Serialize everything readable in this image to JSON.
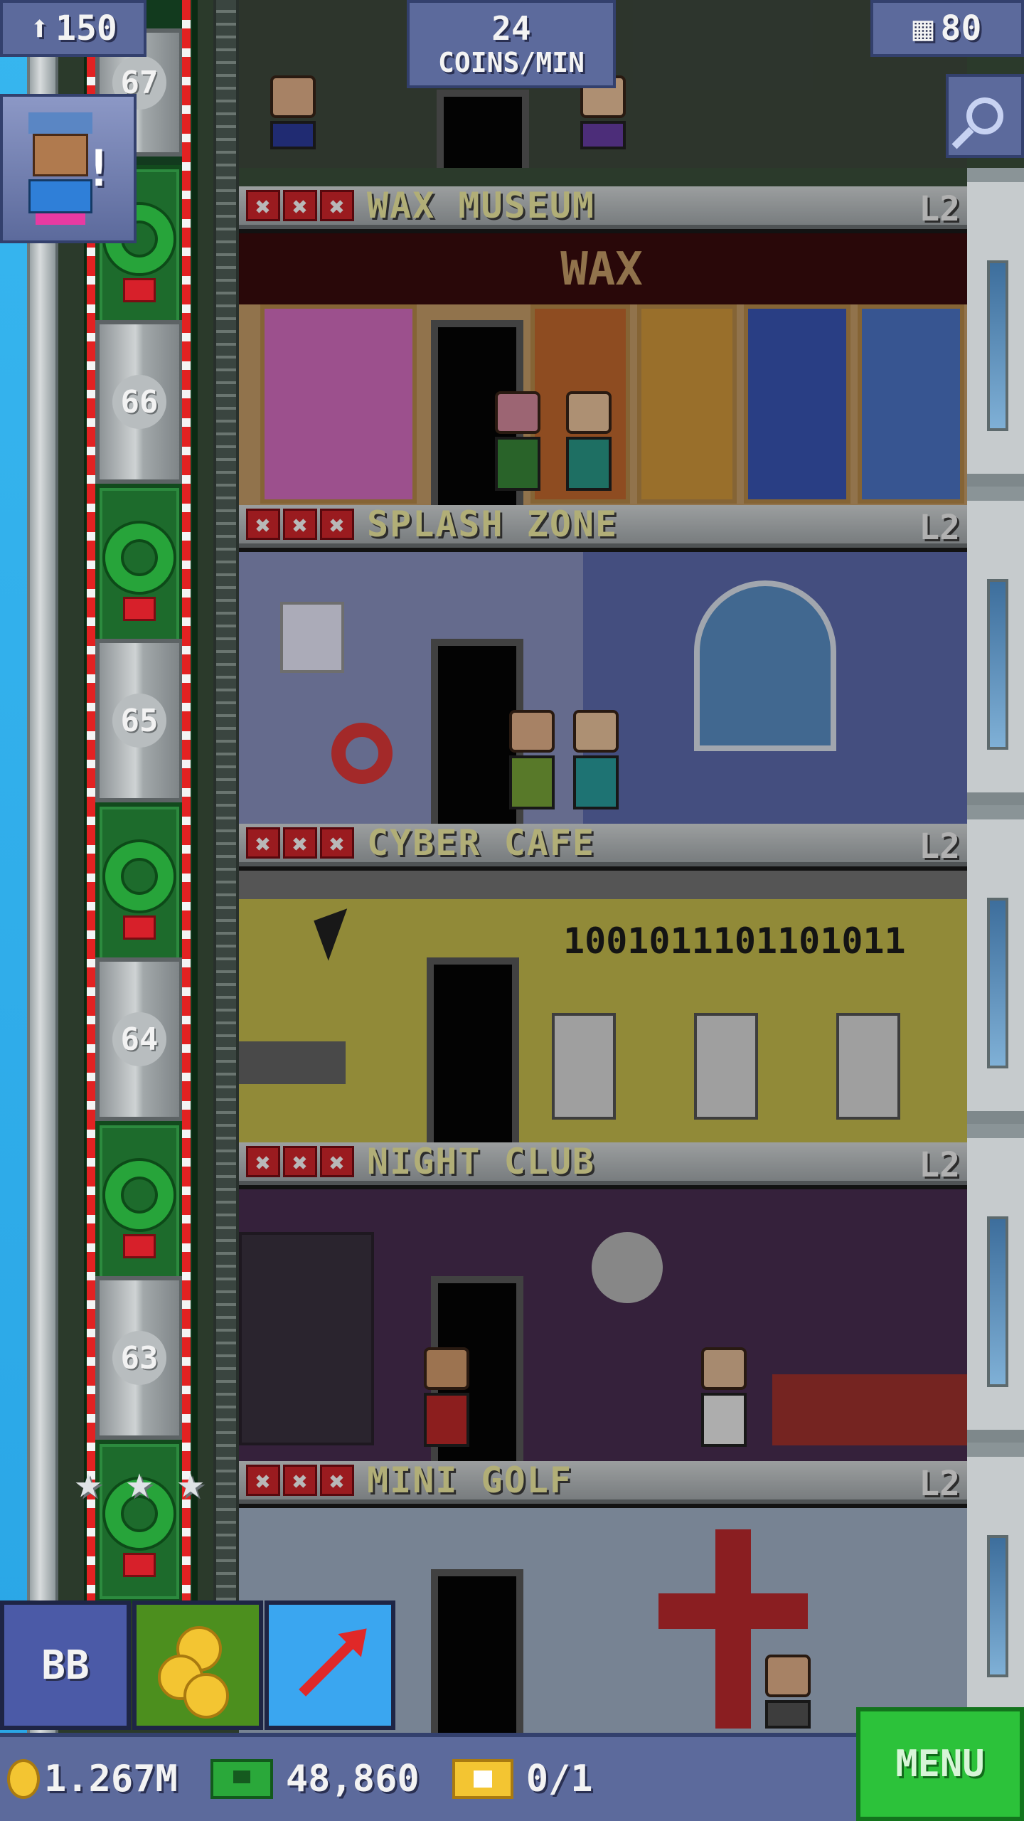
{
  "hud": {
    "population": "150",
    "coins_per_min_value": "24",
    "coins_per_min_label": "COINS/MIN",
    "floor_count": "80",
    "icons": [
      "population-icon",
      "building-icon",
      "magnifier-icon"
    ]
  },
  "elevator": {
    "floor_numbers": [
      "67",
      "66",
      "65",
      "64",
      "63"
    ],
    "colors": {
      "candy_red": "#e32222",
      "wreath_green": "#27a43a",
      "shaft_green": "#1d6b2c"
    }
  },
  "floors": [
    {
      "name": "WAX MUSEUM",
      "level": "L2",
      "sign": "WAX",
      "room_color": "#5b1213"
    },
    {
      "name": "SPLASH ZONE",
      "level": "L2",
      "room_color": "#8c95c4"
    },
    {
      "name": "CYBER CAFE",
      "level": "L2",
      "binary": "1001011101101011",
      "room_color": "#c9c04e"
    },
    {
      "name": "NIGHT CLUB",
      "level": "L2",
      "room_color": "#4a2e52"
    },
    {
      "name": "MINI GOLF",
      "level": "L2",
      "room_color": "#a5b6cc"
    }
  ],
  "buttons": {
    "bb_label": "BB",
    "menu_label": "MENU"
  },
  "bottom_bar": {
    "coins": "1.267M",
    "bux": "48,860",
    "tickets": "0/1"
  }
}
